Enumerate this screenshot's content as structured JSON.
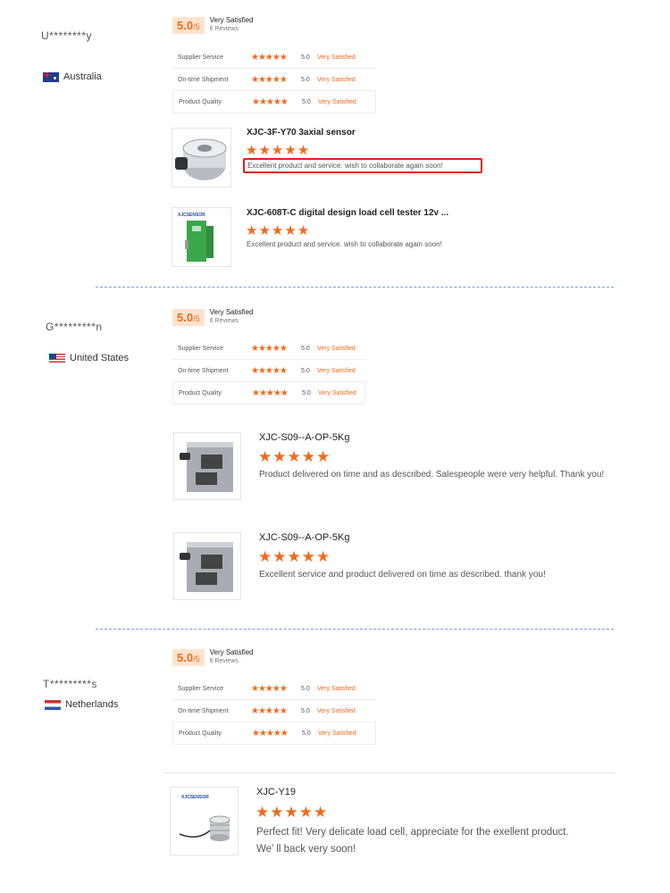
{
  "reviews": [
    {
      "user": "U********y",
      "country": "Australia",
      "score": "5.0",
      "score_suffix": "/5",
      "satisfaction": "Very Satisfied",
      "review_count": "6 Reviews",
      "ratings": [
        {
          "label": "Supplier Service",
          "stars": "★★★★★",
          "value": "5.0",
          "text": "Very Satisfied"
        },
        {
          "label": "On-time Shipment",
          "stars": "★★★★★",
          "value": "5.0",
          "text": "Very Satisfied"
        },
        {
          "label": "Product Quality",
          "stars": "★★★★★",
          "value": "5.0",
          "text": "Very Satisfied"
        }
      ],
      "products": [
        {
          "title": "XJC-3F-Y70 3axial sensor",
          "stars": "★★★★★",
          "text": "Excellent product and service. wish to collaborate again soon!"
        },
        {
          "title": "XJC-608T-C digital design load cell tester 12v ...",
          "stars": "★★★★★",
          "text": "Excellent product and service. wish to collaborate again soon!"
        }
      ]
    },
    {
      "user": "G*********n",
      "country": "United States",
      "score": "5.0",
      "score_suffix": "/5",
      "satisfaction": "Very Satisfied",
      "review_count": "6 Reviews",
      "ratings": [
        {
          "label": "Supplier Service",
          "stars": "★★★★★",
          "value": "5.0",
          "text": "Very Satisfied"
        },
        {
          "label": "On-time Shipment",
          "stars": "★★★★★",
          "value": "5.0",
          "text": "Very Satisfied"
        },
        {
          "label": "Product Quality",
          "stars": "★★★★★",
          "value": "5.0",
          "text": "Very Satisfied"
        }
      ],
      "products": [
        {
          "title": "XJC-S09--A-OP-5Kg",
          "stars": "★★★★★",
          "text": "Product delivered on time and as described. Salespeople were very helpful. Thank you!"
        },
        {
          "title": "XJC-S09--A-OP-5Kg",
          "stars": "★★★★★",
          "text": "Excellent service and product delivered on time as described. thank you!"
        }
      ]
    },
    {
      "user": "T*********s",
      "country": "Netherlands",
      "score": "5.0",
      "score_suffix": "/5",
      "satisfaction": "Very Satisfied",
      "review_count": "6 Reviews",
      "ratings": [
        {
          "label": "Supplier Service",
          "stars": "★★★★★",
          "value": "5.0",
          "text": "Very Satisfied"
        },
        {
          "label": "On-time Shipment",
          "stars": "★★★★★",
          "value": "5.0",
          "text": "Very Satisfied"
        },
        {
          "label": "Product Quality",
          "stars": "★★★★★",
          "value": "5.0",
          "text": "Very Satisfied"
        }
      ],
      "products": [
        {
          "title": "XJC-Y19",
          "stars": "★★★★★",
          "text_line1": "Perfect fit! Very delicate load cell, appreciate for the exellent product.",
          "text_line2": "We’ ll back very soon!"
        }
      ]
    }
  ],
  "brand_logo_text": "XJCSENSOR",
  "colors": {
    "accent": "#f26a1b",
    "score_bg": "#fde3d0",
    "highlight": "#e02020",
    "divider": "#7d9bd6"
  }
}
